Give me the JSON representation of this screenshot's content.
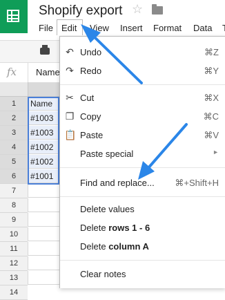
{
  "app": {
    "title": "Shopify export",
    "menus": [
      "File",
      "Edit",
      "View",
      "Insert",
      "Format",
      "Data",
      "T"
    ]
  },
  "formula_bar": {
    "fx_label": "fx",
    "value": "Name"
  },
  "grid": {
    "rows": [
      "1",
      "2",
      "3",
      "4",
      "5",
      "6",
      "7",
      "8",
      "9",
      "10",
      "11",
      "12",
      "13",
      "14"
    ],
    "colA": [
      "Name",
      "#1003",
      "#1003",
      "#1002",
      "#1002",
      "#1001"
    ]
  },
  "edit_menu": {
    "undo": {
      "label": "Undo",
      "shortcut": "⌘Z"
    },
    "redo": {
      "label": "Redo",
      "shortcut": "⌘Y"
    },
    "cut": {
      "label": "Cut",
      "shortcut": "⌘X"
    },
    "copy": {
      "label": "Copy",
      "shortcut": "⌘C"
    },
    "paste": {
      "label": "Paste",
      "shortcut": "⌘V"
    },
    "paste_special": {
      "label": "Paste special"
    },
    "find_replace": {
      "label": "Find and replace...",
      "shortcut": "⌘+Shift+H"
    },
    "delete_values": {
      "label": "Delete values"
    },
    "delete_rows": {
      "prefix": "Delete ",
      "bold": "rows 1 - 6"
    },
    "delete_column": {
      "prefix": "Delete ",
      "bold": "column A"
    },
    "clear_notes": {
      "label": "Clear notes"
    }
  },
  "colors": {
    "accent_green": "#0f9d58",
    "annotation_blue": "#2b86e8",
    "selection_blue": "#4a7fd8"
  },
  "icons": [
    "sheets-logo-icon",
    "star-icon",
    "folder-icon",
    "print-icon",
    "fx-icon",
    "undo-icon",
    "redo-icon",
    "cut-icon",
    "copy-icon",
    "paste-icon",
    "submenu-arrow-icon"
  ]
}
